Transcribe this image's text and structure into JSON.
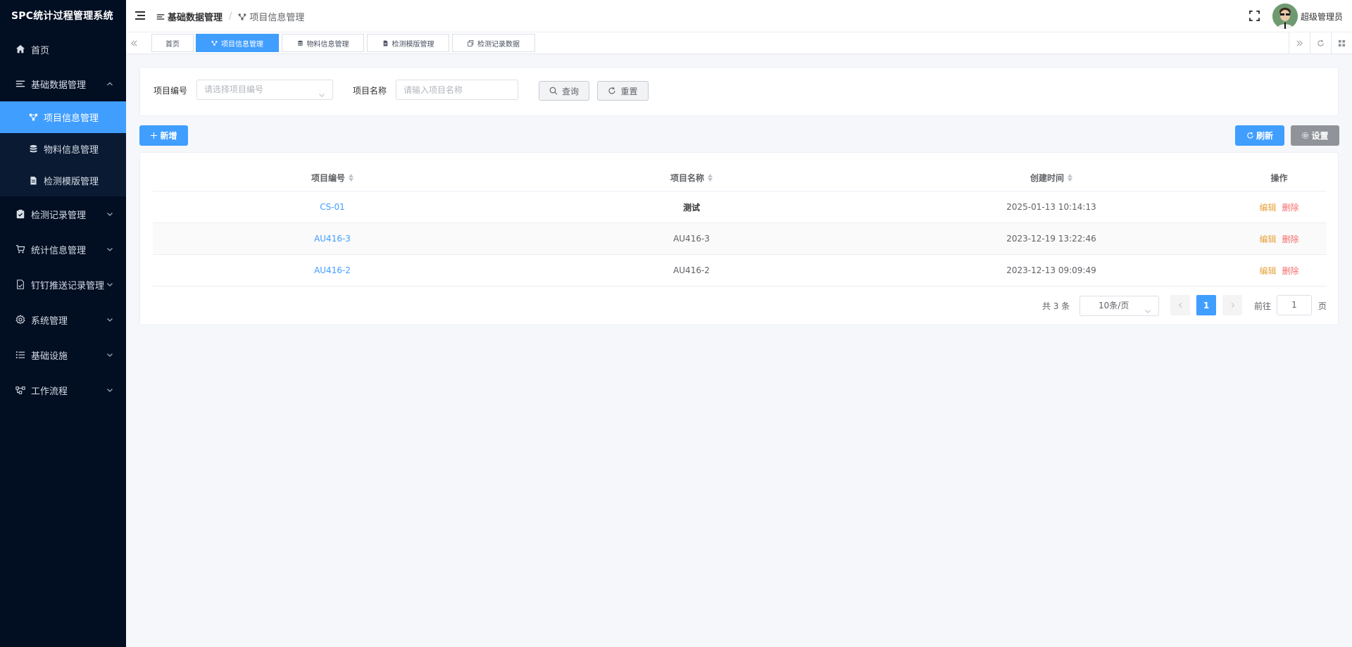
{
  "app": {
    "title": "SPC统计过程管理系统"
  },
  "sidebar": {
    "items": [
      {
        "label": "首页",
        "icon": "home-icon"
      },
      {
        "label": "基础数据管理",
        "icon": "list-icon",
        "expanded": true,
        "children": [
          {
            "label": "项目信息管理",
            "icon": "nodes-icon",
            "active": true
          },
          {
            "label": "物料信息管理",
            "icon": "database-icon"
          },
          {
            "label": "检测模版管理",
            "icon": "document-icon"
          }
        ]
      },
      {
        "label": "检测记录管理",
        "icon": "clipboard-icon"
      },
      {
        "label": "统计信息管理",
        "icon": "cart-icon"
      },
      {
        "label": "钉钉推送记录管理",
        "icon": "file-icon"
      },
      {
        "label": "系统管理",
        "icon": "gear-icon"
      },
      {
        "label": "基础设施",
        "icon": "bullet-list-icon"
      },
      {
        "label": "工作流程",
        "icon": "workflow-icon"
      }
    ]
  },
  "header": {
    "breadcrumb": [
      "基础数据管理",
      "项目信息管理"
    ],
    "separator": "/",
    "user": "超级管理员"
  },
  "tabs": [
    {
      "label": "首页",
      "active": false
    },
    {
      "label": "项目信息管理",
      "active": true
    },
    {
      "label": "物料信息管理",
      "active": false
    },
    {
      "label": "检测模版管理",
      "active": false
    },
    {
      "label": "检测记录数据",
      "active": false
    }
  ],
  "search": {
    "code_label": "项目编号",
    "code_placeholder": "请选择项目编号",
    "name_label": "项目名称",
    "name_placeholder": "请输入项目名称",
    "query_label": "查询",
    "reset_label": "重置"
  },
  "toolbar": {
    "add_label": "新增",
    "refresh_label": "刷新",
    "settings_label": "设置"
  },
  "table": {
    "columns": [
      "项目编号",
      "项目名称",
      "创建时间",
      "操作"
    ],
    "rows": [
      {
        "code": "CS-01",
        "name": "测试",
        "created": "2025-01-13 10:14:13"
      },
      {
        "code": "AU416-3",
        "name": "AU416-3",
        "created": "2023-12-19 13:22:46"
      },
      {
        "code": "AU416-2",
        "name": "AU416-2",
        "created": "2023-12-13 09:09:49"
      }
    ],
    "edit_label": "编辑",
    "delete_label": "删除"
  },
  "pagination": {
    "total": "共 3 条",
    "page_size": "10条/页",
    "current_page": "1",
    "goto_prefix": "前往",
    "goto_value": "1",
    "goto_suffix": "页"
  },
  "colors": {
    "primary": "#409eff",
    "sidebar_bg": "#020e22",
    "edit": "#e6a23c",
    "delete": "#f56c6c"
  }
}
